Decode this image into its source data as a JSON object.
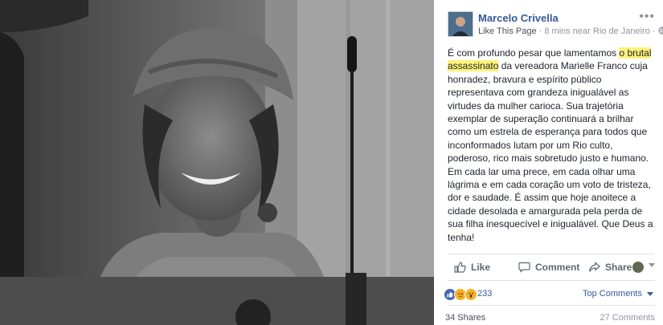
{
  "post": {
    "author": "Marcelo Crivella",
    "like_page": "Like This Page",
    "meta": " · 8 mins near Rio de Janeiro · ",
    "text_before": "É com profundo pesar que lamentamos ",
    "text_highlight": "o brutal assassinato",
    "text_after": " da vereadora Marielle Franco cuja honradez, bravura e espírito público representava com grandeza inigualável as virtudes da mulher carioca. Sua trajetória exemplar de superação continuará a brilhar como um estrela de esperança para todos que inconformados lutam por um Rio culto, poderoso, rico mais sobretudo justo e humano. Em cada lar uma prece, em cada olhar uma lágrima e em cada coração um voto de tristeza, dor e saudade. É assim que hoje anoitece a cidade desolada e amargurada pela perda de sua filha inesquecível e inigualável. Que Deus a tenha!"
  },
  "actions": {
    "like": "Like",
    "comment": "Comment",
    "share": "Share"
  },
  "stats": {
    "reaction_count": "233",
    "top_comments": "Top Comments",
    "shares": "34 Shares",
    "comments": "27 Comments"
  },
  "colors": {
    "link": "#365899",
    "highlight": "#fff27a"
  },
  "icons": [
    "photo",
    "avatar",
    "globe-icon",
    "more-icon",
    "like-icon",
    "comment-icon",
    "share-icon",
    "reaction-like-icon",
    "reaction-sad-icon",
    "reaction-wow-icon"
  ]
}
